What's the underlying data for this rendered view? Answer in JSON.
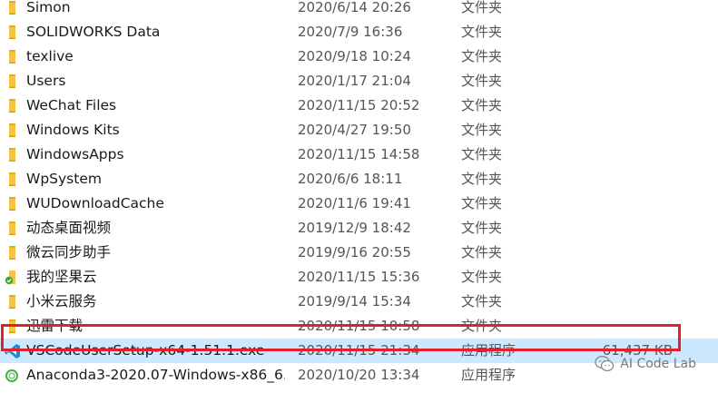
{
  "file_list": {
    "rows": [
      {
        "name": "Simon",
        "date": "2020/6/14 20:26",
        "type": "文件夹",
        "size": "",
        "icon": "folder-icon"
      },
      {
        "name": "SOLIDWORKS Data",
        "date": "2020/7/9 16:36",
        "type": "文件夹",
        "size": "",
        "icon": "folder-icon"
      },
      {
        "name": "texlive",
        "date": "2020/9/18 10:24",
        "type": "文件夹",
        "size": "",
        "icon": "folder-icon"
      },
      {
        "name": "Users",
        "date": "2020/1/17 21:04",
        "type": "文件夹",
        "size": "",
        "icon": "folder-icon"
      },
      {
        "name": "WeChat Files",
        "date": "2020/11/15 20:52",
        "type": "文件夹",
        "size": "",
        "icon": "folder-icon"
      },
      {
        "name": "Windows Kits",
        "date": "2020/4/27 19:50",
        "type": "文件夹",
        "size": "",
        "icon": "folder-icon"
      },
      {
        "name": "WindowsApps",
        "date": "2020/11/15 14:58",
        "type": "文件夹",
        "size": "",
        "icon": "folder-icon"
      },
      {
        "name": "WpSystem",
        "date": "2020/6/6 18:11",
        "type": "文件夹",
        "size": "",
        "icon": "folder-icon"
      },
      {
        "name": "WUDownloadCache",
        "date": "2020/11/6 19:41",
        "type": "文件夹",
        "size": "",
        "icon": "folder-icon"
      },
      {
        "name": "动态桌面视频",
        "date": "2019/12/9 18:42",
        "type": "文件夹",
        "size": "",
        "icon": "folder-icon"
      },
      {
        "name": "微云同步助手",
        "date": "2019/9/16 20:55",
        "type": "文件夹",
        "size": "",
        "icon": "folder-icon"
      },
      {
        "name": "我的坚果云",
        "date": "2020/11/15 15:36",
        "type": "文件夹",
        "size": "",
        "icon": "synced-folder-icon"
      },
      {
        "name": "小米云服务",
        "date": "2019/9/14 15:34",
        "type": "文件夹",
        "size": "",
        "icon": "folder-icon"
      },
      {
        "name": "迅雷下载",
        "date": "2020/11/15 10:58",
        "type": "文件夹",
        "size": "",
        "icon": "folder-icon"
      },
      {
        "name": "VSCodeUserSetup-x64-1.51.1.exe",
        "date": "2020/11/15 21:34",
        "type": "应用程序",
        "size": "61,437 KB",
        "icon": "vscode-icon",
        "selected": true
      },
      {
        "name": "Anaconda3-2020.07-Windows-x86_6...",
        "date": "2020/10/20 13:34",
        "type": "应用程序",
        "size": "",
        "icon": "anaconda-icon"
      }
    ]
  },
  "watermark": {
    "text": "AI Code Lab",
    "icon": "wechat-icon"
  },
  "colors": {
    "folder": "#f4c542",
    "selection": "#cce8ff",
    "highlight_border": "#e0202a",
    "vscode_blue": "#1f8ad2",
    "anaconda_green": "#43b049"
  }
}
